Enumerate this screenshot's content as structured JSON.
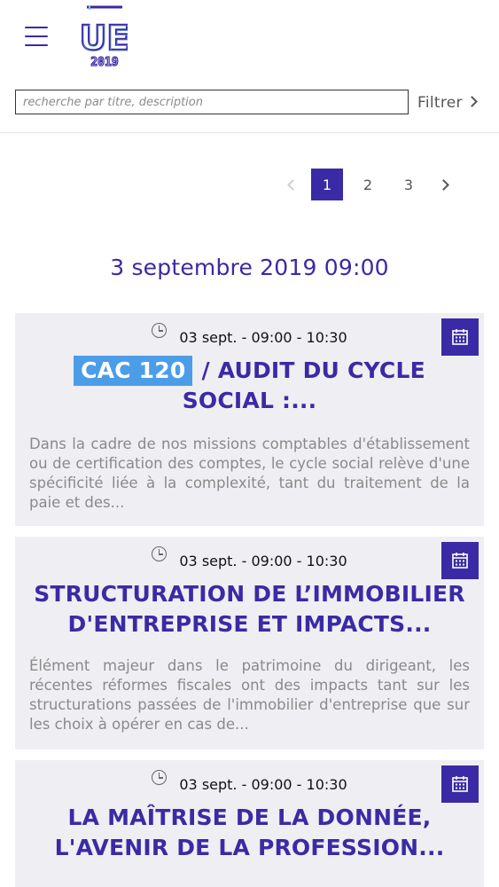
{
  "header": {
    "logo": {
      "letters": "UE",
      "year": "2019"
    }
  },
  "search": {
    "placeholder": "recherche par titre, description",
    "value": "",
    "filter_label": "Filtrer"
  },
  "pagination": {
    "pages": [
      "1",
      "2",
      "3"
    ],
    "current": "1"
  },
  "date_heading": "3 septembre 2019 09:00",
  "colors": {
    "accent": "#3b2aa5",
    "tag": "#4c9de8",
    "card_bg": "#efeef2",
    "desc_text": "#8a8a8a"
  },
  "sessions": [
    {
      "time": "03 sept. - 09:00 - 10:30",
      "tag": "CAC 120",
      "title": "/ AUDIT DU CYCLE SOCIAL :...",
      "description": "Dans la cadre de nos missions comptables d'établissement ou de certification des comptes, le cycle social relève d'une spécificité liée à la complexité, tant du traitement de la paie et des..."
    },
    {
      "time": "03 sept. - 09:00 - 10:30",
      "tag": "",
      "title": "STRUCTURATION DE L’IMMOBILIER D'ENTREPRISE ET IMPACTS...",
      "description": "Élément majeur dans le patrimoine du dirigeant, les récentes réformes fiscales ont des impacts tant sur les structurations passées de l'immobilier d'entreprise que sur les choix à opérer en cas de..."
    },
    {
      "time": "03 sept. - 09:00 - 10:30",
      "tag": "",
      "title": "LA MAÎTRISE DE LA DONNÉE, L'AVENIR DE LA PROFESSION...",
      "description": ""
    }
  ]
}
